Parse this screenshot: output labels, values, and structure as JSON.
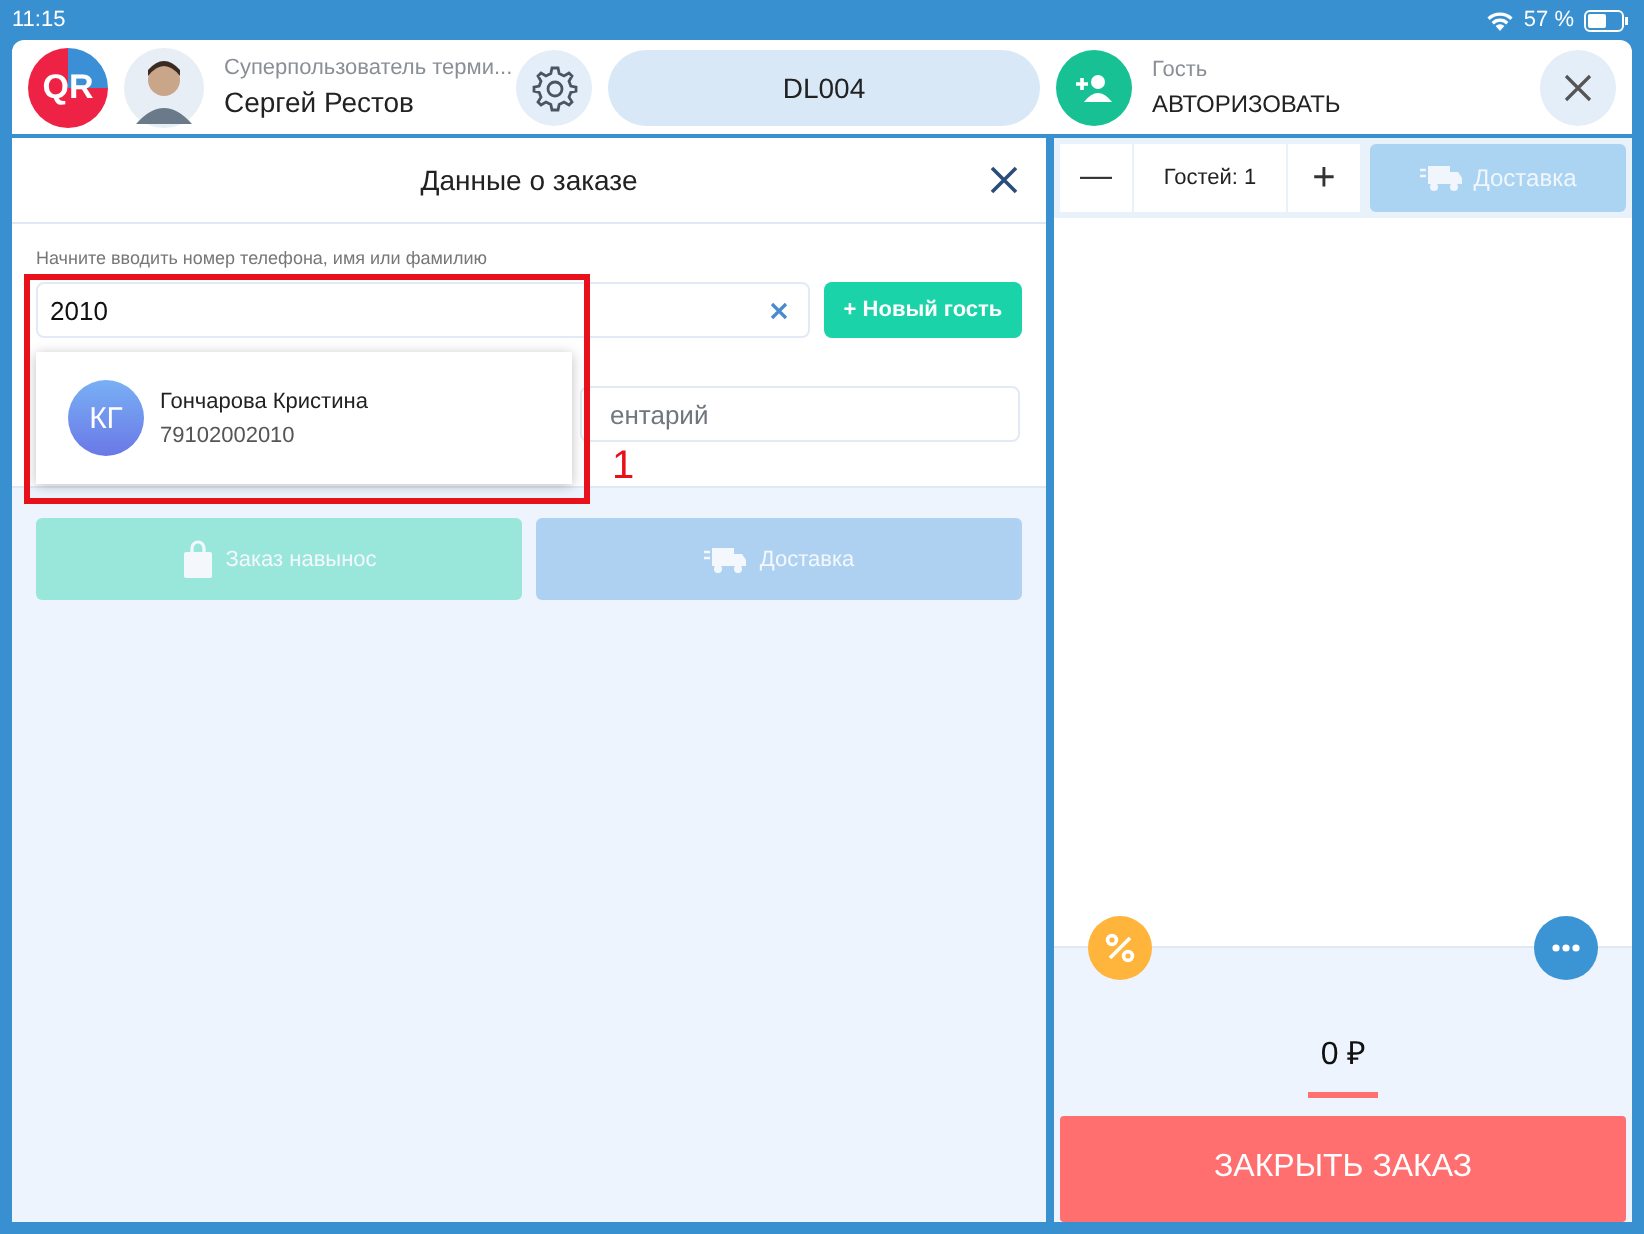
{
  "status_bar": {
    "time": "11:15",
    "battery": "57 %"
  },
  "header": {
    "logo": "QR",
    "user_role": "Суперпользователь терми...",
    "user_name": "Сергей Рестов",
    "order_code": "DL004",
    "guest_label": "Гость",
    "guest_action": "АВТОРИЗОВАТЬ"
  },
  "order_panel": {
    "title": "Данные о заказе",
    "search_label": "Начните вводить номер телефона, имя или фамилию",
    "search_value": "2010",
    "new_guest_button": "+ Новый гость",
    "comment_placeholder": "ентарий",
    "suggestions": [
      {
        "initials": "КГ",
        "name": "Гончарова Кристина",
        "phone": "79102002010"
      }
    ],
    "order_types": [
      {
        "kind": "takeaway",
        "label": "Заказ навынос",
        "disabled": true
      },
      {
        "kind": "delivery",
        "label": "Доставка",
        "disabled": true
      }
    ]
  },
  "annotation": {
    "label": "1"
  },
  "cart": {
    "minus": "—",
    "guests": "Гостей: 1",
    "plus": "+",
    "delivery_button": {
      "label": "Доставка",
      "disabled": true
    },
    "total": "0 ₽",
    "close_button": "ЗАКРЫТЬ ЗАКАЗ"
  }
}
